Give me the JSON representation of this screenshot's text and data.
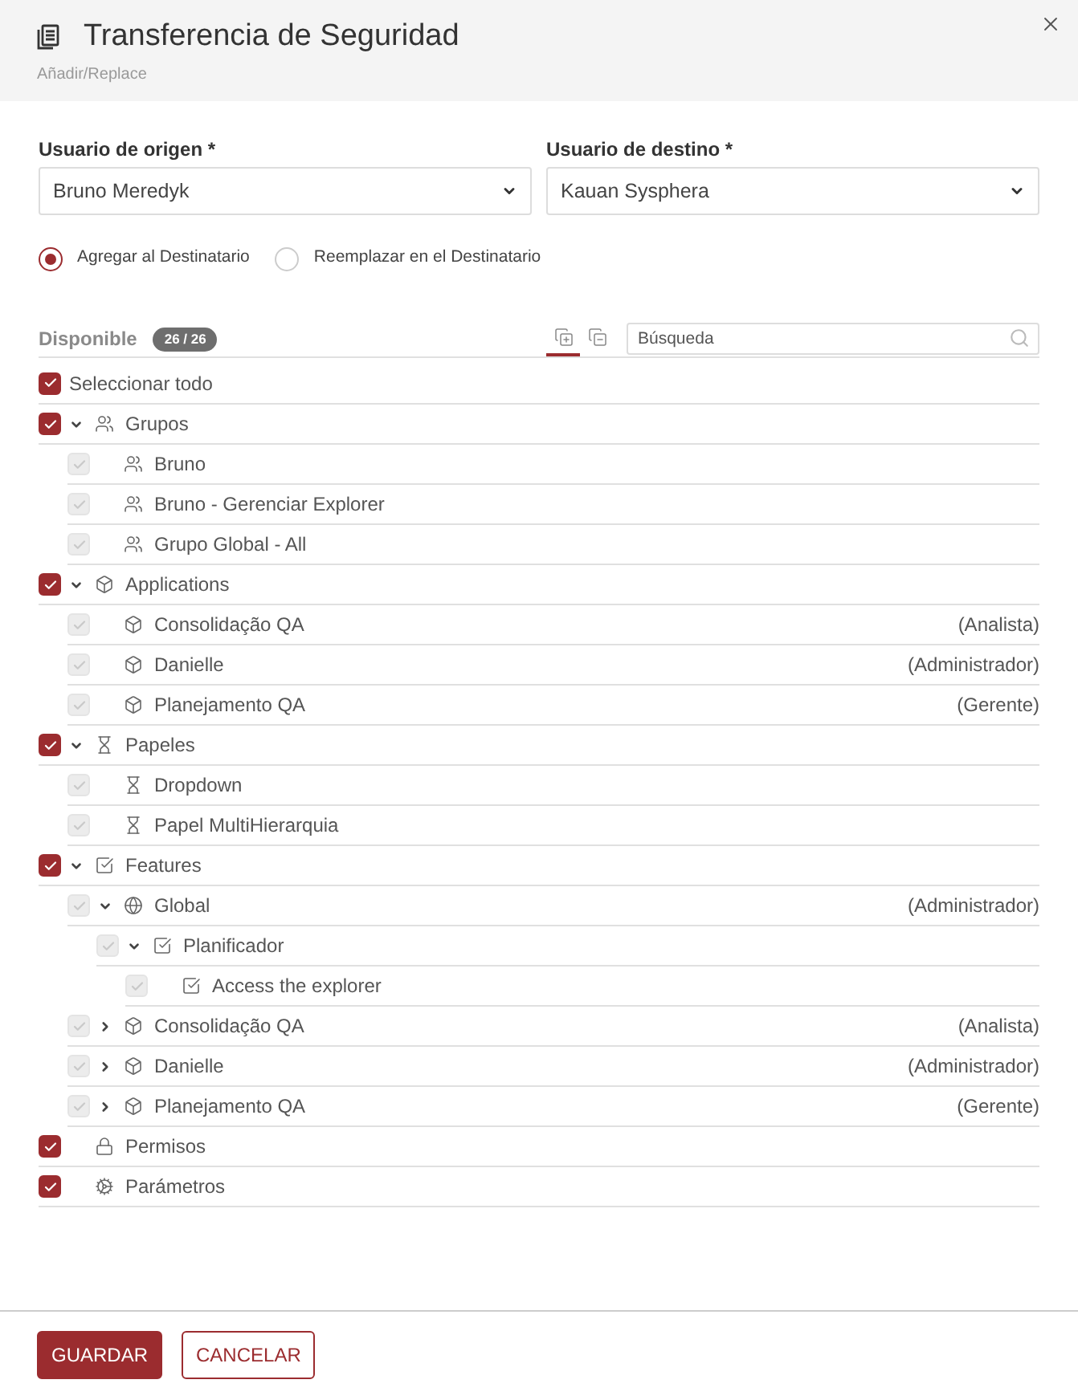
{
  "dialog": {
    "title": "Transferencia de Seguridad",
    "subtitle": "Añadir/Replace"
  },
  "fields": [
    {
      "label": "Usuario de origen *",
      "value": "Bruno Meredyk"
    },
    {
      "label": "Usuario de destino *",
      "value": "Kauan Sysphera"
    }
  ],
  "mode_options": [
    {
      "label": "Agregar al Destinatario",
      "selected": true
    },
    {
      "label": "Reemplazar en el Destinatario",
      "selected": false
    }
  ],
  "available": {
    "label": "Disponible",
    "count": "26 / 26",
    "view_toggles": [
      {
        "kind": "expand_all",
        "selected": true
      },
      {
        "kind": "collapse_all",
        "selected": false
      }
    ],
    "search": {
      "placeholder": "Búsqueda"
    }
  },
  "tree": {
    "select_all": {
      "label": "Seleccionar todo",
      "checked": true
    },
    "items": [
      {
        "kind": "group",
        "label": "Grupos",
        "checked": true,
        "disabled": false,
        "expanded": true,
        "children": [
          {
            "kind": "group",
            "label": "Bruno",
            "checked": true,
            "disabled": true
          },
          {
            "kind": "group",
            "label": "Bruno - Gerenciar Explorer",
            "checked": true,
            "disabled": true
          },
          {
            "kind": "group",
            "label": "Grupo Global - All",
            "checked": true,
            "disabled": true
          }
        ]
      },
      {
        "kind": "application",
        "label": "Applications",
        "checked": true,
        "disabled": false,
        "expanded": true,
        "children": [
          {
            "kind": "application",
            "label": "Consolidação QA",
            "role": "(Analista)",
            "checked": true,
            "disabled": true
          },
          {
            "kind": "application",
            "label": "Danielle",
            "role": "(Administrador)",
            "checked": true,
            "disabled": true
          },
          {
            "kind": "application",
            "label": "Planejamento QA",
            "role": "(Gerente)",
            "checked": true,
            "disabled": true
          }
        ]
      },
      {
        "kind": "role",
        "label": "Papeles",
        "checked": true,
        "disabled": false,
        "expanded": true,
        "children": [
          {
            "kind": "role",
            "label": "Dropdown",
            "checked": true,
            "disabled": true
          },
          {
            "kind": "role",
            "label": "Papel MultiHierarquia",
            "checked": true,
            "disabled": true
          }
        ]
      },
      {
        "kind": "feature",
        "label": "Features",
        "checked": true,
        "disabled": false,
        "expanded": true,
        "children": [
          {
            "kind": "environment",
            "label": "Global",
            "role": "(Administrador)",
            "checked": true,
            "disabled": true,
            "expanded": true,
            "children": [
              {
                "kind": "feature",
                "label": "Planificador",
                "checked": true,
                "disabled": true,
                "expanded": true,
                "children": [
                  {
                    "kind": "feature",
                    "label": "Access the explorer",
                    "checked": true,
                    "disabled": true
                  }
                ]
              }
            ]
          },
          {
            "kind": "application",
            "label": "Consolidação QA",
            "role": "(Analista)",
            "checked": true,
            "disabled": true,
            "expanded": false
          },
          {
            "kind": "application",
            "label": "Danielle",
            "role": "(Administrador)",
            "checked": true,
            "disabled": true,
            "expanded": false
          },
          {
            "kind": "application",
            "label": "Planejamento QA",
            "role": "(Gerente)",
            "checked": true,
            "disabled": true,
            "expanded": false
          }
        ]
      },
      {
        "kind": "permission",
        "label": "Permisos",
        "checked": true,
        "disabled": false
      },
      {
        "kind": "parameter",
        "label": "Parámetros",
        "checked": true,
        "disabled": false
      }
    ]
  },
  "buttons": [
    {
      "kind": "primary",
      "label": "GUARDAR"
    },
    {
      "kind": "secondary",
      "label": "CANCELAR"
    }
  ]
}
